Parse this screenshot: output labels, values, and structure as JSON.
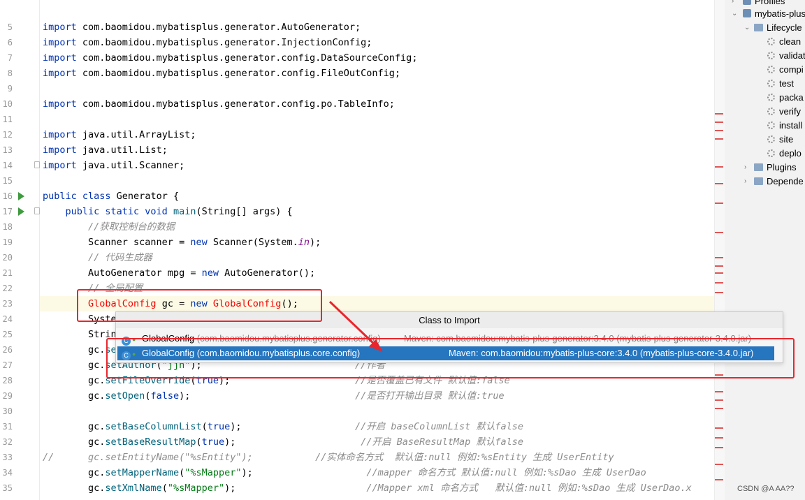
{
  "editor": {
    "lines": [
      {
        "n": "5",
        "code": "<span class=\"kw\">import</span> com.baomidou.mybatisplus.generator.AutoGenerator;"
      },
      {
        "n": "6",
        "code": "<span class=\"kw\">import</span> com.baomidou.mybatisplus.generator.InjectionConfig;"
      },
      {
        "n": "7",
        "code": "<span class=\"kw\">import</span> com.baomidou.mybatisplus.generator.config.DataSourceConfig;"
      },
      {
        "n": "8",
        "code": "<span class=\"kw\">import</span> com.baomidou.mybatisplus.generator.config.FileOutConfig;"
      },
      {
        "n": "9",
        "code": ""
      },
      {
        "n": "10",
        "code": "<span class=\"kw\">import</span> com.baomidou.mybatisplus.generator.config.po.TableInfo;"
      },
      {
        "n": "11",
        "code": ""
      },
      {
        "n": "12",
        "code": "<span class=\"kw\">import</span> java.util.ArrayList;"
      },
      {
        "n": "13",
        "code": "<span class=\"kw\">import</span> java.util.List;"
      },
      {
        "n": "14",
        "code": "<span class=\"kw\">import</span> java.util.Scanner;"
      },
      {
        "n": "15",
        "code": ""
      },
      {
        "n": "16",
        "code": "<span class=\"kw\">public class</span> Generator {"
      },
      {
        "n": "17",
        "code": "    <span class=\"kw\">public static void</span> <span class=\"mth\">main</span>(String[] args) {"
      },
      {
        "n": "18",
        "code": "        <span class=\"cmt\">//获取控制台的数据</span>"
      },
      {
        "n": "19",
        "code": "        Scanner scanner = <span class=\"kw\">new</span> Scanner(System.<span class=\"fld\">in</span>);"
      },
      {
        "n": "20",
        "code": "        <span class=\"cmt\">// 代码生成器</span>"
      },
      {
        "n": "21",
        "code": "        AutoGenerator mpg = <span class=\"kw\">new</span> AutoGenerator();"
      },
      {
        "n": "22",
        "code": "        <span class=\"cmt\">// 全局配置</span>"
      },
      {
        "n": "23",
        "code": "        <span class=\"err\">GlobalConfig</span> gc = <span class=\"kw\">new</span> <span class=\"err\">GlobalConfig</span>();"
      },
      {
        "n": "24",
        "code": "        Syste"
      },
      {
        "n": "25",
        "code": "        Strin"
      },
      {
        "n": "26",
        "code": "        gc.<span class=\"mth\">se</span>"
      },
      {
        "n": "27",
        "code": "        gc.<span class=\"mth\">setAuthor</span>(<span class=\"str\">\"jjh\"</span>);                           <span class=\"cmt\">//作者</span>"
      },
      {
        "n": "28",
        "code": "        gc.<span class=\"mth\">setFileOverride</span>(<span class=\"kw\">true</span>);                      <span class=\"cmt\">//是否覆盖已有文件 默认值:false</span>"
      },
      {
        "n": "29",
        "code": "        gc.<span class=\"mth\">setOpen</span>(<span class=\"kw\">false</span>);                             <span class=\"cmt\">//是否打开输出目录 默认值:true</span>"
      },
      {
        "n": "30",
        "code": ""
      },
      {
        "n": "31",
        "code": "        gc.<span class=\"mth\">setBaseColumnList</span>(<span class=\"kw\">true</span>);                    <span class=\"cmt\">//开启 baseColumnList 默认false</span>"
      },
      {
        "n": "32",
        "code": "        gc.<span class=\"mth\">setBaseResultMap</span>(<span class=\"kw\">true</span>);                      <span class=\"cmt\">//开启 BaseResultMap 默认false</span>"
      },
      {
        "n": "33",
        "code": "<span class=\"cmt\">//      gc.setEntityName(\"%sEntity\");           //实体命名方式  默认值:null 例如:%sEntity 生成 UserEntity</span>"
      },
      {
        "n": "34",
        "code": "        gc.<span class=\"mth\">setMapperName</span>(<span class=\"str\">\"%sMapper\"</span>);                    <span class=\"cmt\">//mapper 命名方式 默认值:null 例如:%sDao 生成 UserDao</span>"
      },
      {
        "n": "35",
        "code": "        gc.<span class=\"mth\">setXmlName</span>(<span class=\"str\">\"%sMapper\"</span>);                       <span class=\"cmt\">//Mapper xml 命名方式   默认值:null 例如:%sDao 生成 UserDao.x</span>"
      }
    ]
  },
  "maven_panel": {
    "profiles_label": "Profiles",
    "project_label": "mybatis-plus",
    "lifecycle_label": "Lifecycle",
    "lifecycle_items": [
      "clean",
      "validat",
      "compi",
      "test",
      "packa",
      "verify",
      "install",
      "site",
      "deplo"
    ],
    "plugins_label": "Plugins",
    "dependencies_label": "Depende"
  },
  "import_popup": {
    "title": "Class to Import",
    "options": [
      {
        "name": "GlobalConfig",
        "pkg": "(com.baomidou.mybatisplus.generator.config)",
        "source": "Maven: com.baomidou:mybatis-plus-generator:3.4.0 (mybatis-plus-generator-3.4.0.jar)"
      },
      {
        "name": "GlobalConfig",
        "pkg": "(com.baomidou.mybatisplus.core.config)",
        "source": "Maven: com.baomidou:mybatis-plus-core:3.4.0 (mybatis-plus-core-3.4.0.jar)"
      }
    ],
    "selected_index": 1
  },
  "watermark": "CSDN @A AA??",
  "colors": {
    "annotation_red": "#e8262d",
    "selection_blue": "#2675bf"
  }
}
